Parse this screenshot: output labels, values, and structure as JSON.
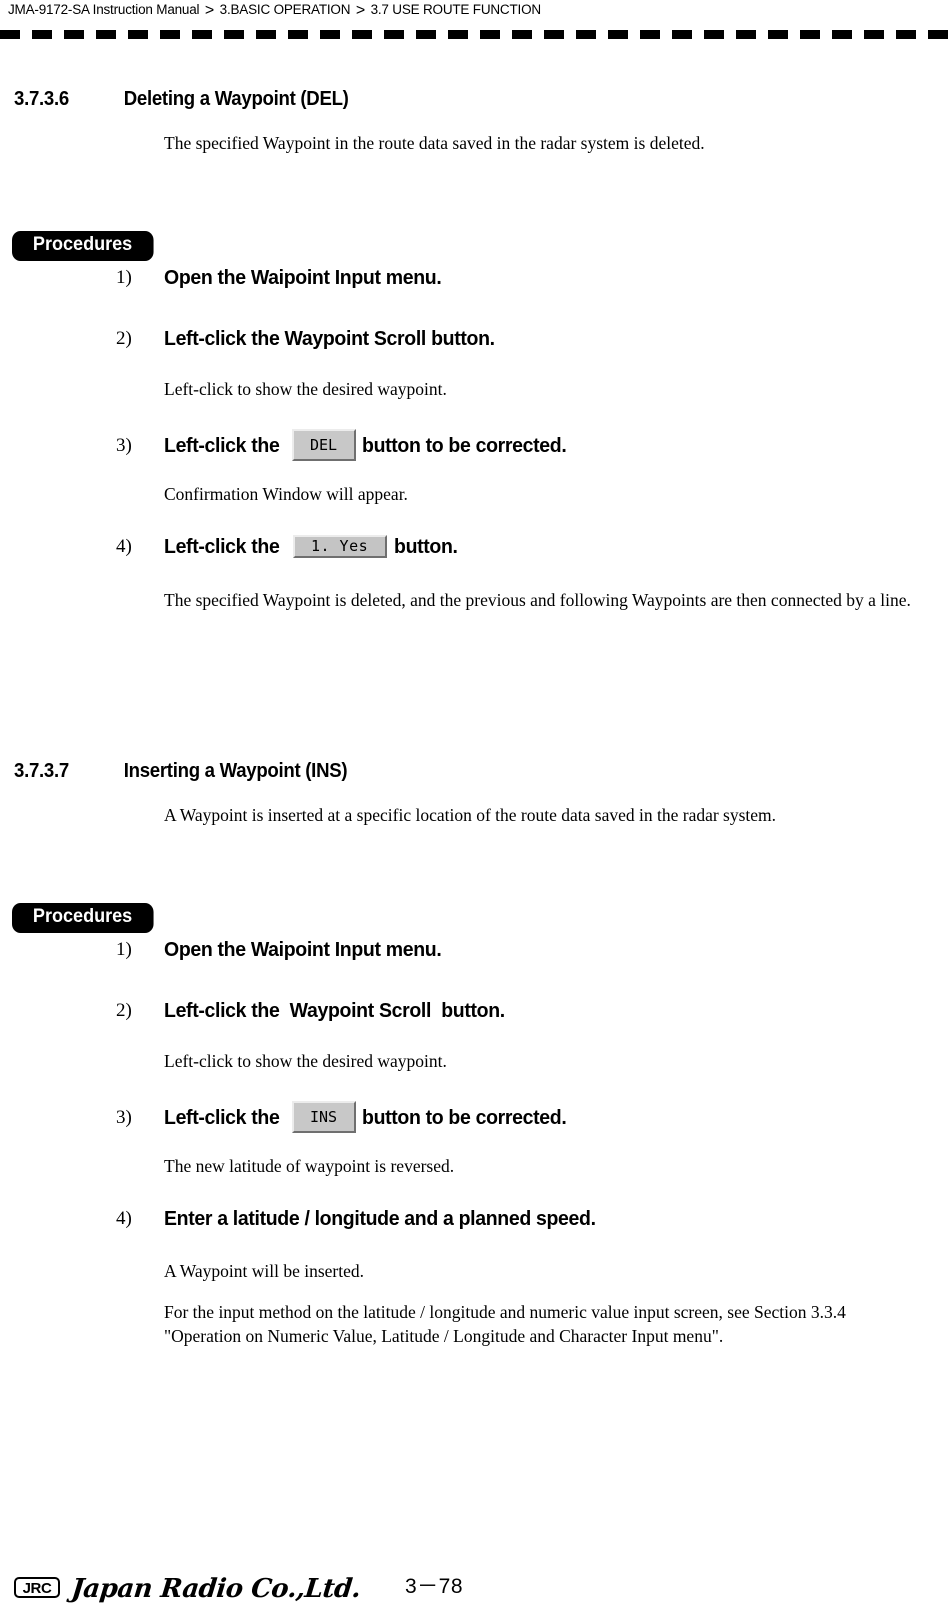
{
  "header": {
    "breadcrumb": [
      "JMA-9172-SA Instruction Manual",
      "3.BASIC OPERATION",
      "3.7  USE ROUTE FUNCTION"
    ],
    "separator": ">"
  },
  "sections": [
    {
      "number": "3.7.3.6",
      "title": "Deleting a Waypoint (DEL)",
      "intro": "The specified Waypoint in the route data saved in the radar system is deleted.",
      "procedures_label": "Procedures",
      "steps": [
        {
          "num": "1)",
          "text_before": "Open the Waipoint Input menu.",
          "button": null,
          "text_after": "",
          "note": null
        },
        {
          "num": "2)",
          "text_before": "Left-click the Waypoint Scroll button.",
          "button": null,
          "text_after": "",
          "note": "Left-click to show the desired waypoint."
        },
        {
          "num": "3)",
          "text_before": "Left-click the",
          "button": "DEL",
          "button_style": "tall",
          "text_after": "button to be corrected.",
          "note": "Confirmation Window will appear."
        },
        {
          "num": "4)",
          "text_before": "Left-click the",
          "button": "1. Yes",
          "button_style": "flat",
          "text_after": "button.",
          "note": "The specified Waypoint is deleted, and the previous and following Waypoints are then connected by a line."
        }
      ]
    },
    {
      "number": "3.7.3.7",
      "title": "Inserting a Waypoint (INS)",
      "intro": "A Waypoint is inserted at a specific location of the route data saved in the radar system.",
      "procedures_label": "Procedures",
      "steps": [
        {
          "num": "1)",
          "text_before": "Open the Waipoint Input menu.",
          "button": null,
          "text_after": "",
          "note": null
        },
        {
          "num": "2)",
          "text_before": "Left-click the  Waypoint Scroll  button.",
          "button": null,
          "text_after": "",
          "note": "Left-click to show the desired waypoint."
        },
        {
          "num": "3)",
          "text_before": "Left-click the",
          "button": "INS",
          "button_style": "tall",
          "text_after": "button to be corrected.",
          "note": "The new latitude of waypoint is reversed."
        },
        {
          "num": "4)",
          "text_before": "Enter a latitude / longitude and a planned speed.",
          "button": null,
          "text_after": "",
          "note": "A Waypoint will be inserted.",
          "note2": "For the input method on the latitude / longitude and numeric value input screen, see Section 3.3.4 \"Operation on Numeric Value, Latitude / Longitude and Character Input menu\"."
        }
      ]
    }
  ],
  "footer": {
    "logo_text": "JRC",
    "company": "Japan Radio Co.,Ltd.",
    "page_number": "3－78"
  }
}
